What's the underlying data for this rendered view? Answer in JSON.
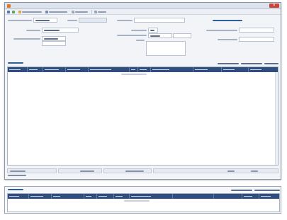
{
  "window": {
    "title": ""
  },
  "toolbar": {
    "items": [
      "",
      "",
      "",
      ""
    ]
  },
  "header_form": {
    "fields": [
      {
        "label": "",
        "value": ""
      },
      {
        "label": "",
        "value": ""
      },
      {
        "label": "",
        "value": ""
      },
      {
        "label": "",
        "value": ""
      },
      {
        "label": "",
        "value": ""
      },
      {
        "label": "",
        "value": ""
      },
      {
        "label": "",
        "value": ""
      },
      {
        "label": "",
        "value": ""
      },
      {
        "label": "",
        "value": ""
      },
      {
        "label": "",
        "value": ""
      },
      {
        "label": "",
        "value": ""
      }
    ],
    "link": ""
  },
  "details": {
    "title": "",
    "actions": [
      "",
      "",
      ""
    ],
    "columns": [
      "",
      "",
      "",
      "",
      "",
      "",
      "",
      "",
      "",
      "",
      ""
    ],
    "hint": ""
  },
  "totals": {
    "fields": [
      {
        "label": "",
        "value": ""
      },
      {
        "label": "",
        "value": ""
      },
      {
        "label": "",
        "value": ""
      },
      {
        "label": "",
        "value": ""
      }
    ],
    "note": ""
  },
  "lower_panel": {
    "title": "",
    "actions": [
      "",
      ""
    ],
    "columns": [
      "",
      "",
      "",
      "",
      "",
      "",
      "",
      "",
      "",
      "",
      "",
      ""
    ],
    "hint": ""
  },
  "colors": {
    "accent": "#2f4d7e",
    "link": "#2f5e9f",
    "close": "#c9443b",
    "app_icon": "#e07b1f"
  }
}
